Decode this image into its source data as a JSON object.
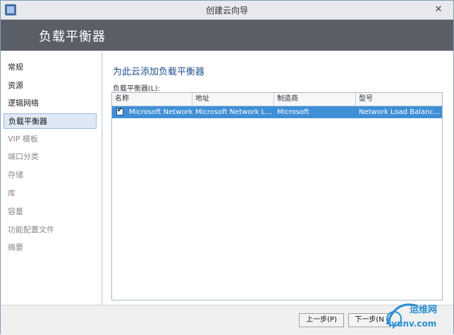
{
  "window": {
    "title": "创建云向导",
    "close_symbol": "✕"
  },
  "header": {
    "title": "负载平衡器"
  },
  "sidebar": {
    "items": [
      {
        "label": "常规",
        "state": "normal"
      },
      {
        "label": "资源",
        "state": "normal"
      },
      {
        "label": "逻辑网络",
        "state": "normal"
      },
      {
        "label": "负载平衡器",
        "state": "active"
      },
      {
        "label": "VIP 模板",
        "state": "disabled"
      },
      {
        "label": "端口分类",
        "state": "disabled"
      },
      {
        "label": "存储",
        "state": "disabled"
      },
      {
        "label": "库",
        "state": "disabled"
      },
      {
        "label": "容量",
        "state": "disabled"
      },
      {
        "label": "功能配置文件",
        "state": "disabled"
      },
      {
        "label": "摘要",
        "state": "disabled"
      }
    ]
  },
  "main": {
    "section_title": "为此云添加负载平衡器",
    "list_label": "负载平衡器(L):",
    "columns": [
      "名称",
      "地址",
      "制造商",
      "型号"
    ],
    "rows": [
      {
        "checked": true,
        "cells": [
          "Microsoft Network",
          "Microsoft Network L...",
          "Microsoft",
          "Network Load Balanc..."
        ]
      }
    ]
  },
  "footer": {
    "prev_label": "上一步(P)",
    "next_label": "下一步(N"
  },
  "watermark": {
    "brand": "运维网",
    "site": "iyunv.com"
  },
  "colors": {
    "header_bg": "#5a5f67",
    "selection": "#3f8fd6",
    "accent_text": "#1f4e8c"
  }
}
